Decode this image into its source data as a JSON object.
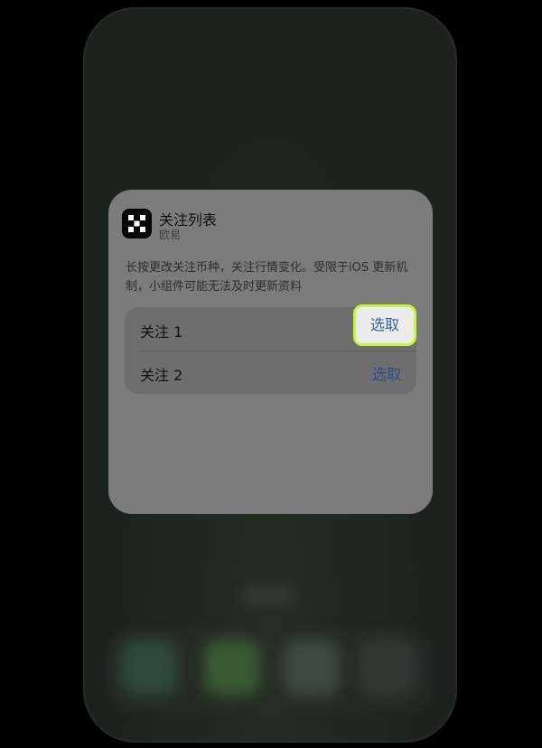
{
  "widget": {
    "title": "关注列表",
    "app_name": "欧易",
    "app_icon": "okx-logo-icon",
    "description": "长按更改关注币种，关注行情变化。受限于iOS 更新机制，小组件可能无法及时更新资料"
  },
  "options": [
    {
      "label": "关注 1",
      "action_label": "选取",
      "highlighted": true
    },
    {
      "label": "关注 2",
      "action_label": "选取",
      "highlighted": false
    }
  ],
  "colors": {
    "highlight_border": "#c8f53a",
    "action_text": "#2b4e86",
    "sheet_bg": "#7b7b7b"
  }
}
